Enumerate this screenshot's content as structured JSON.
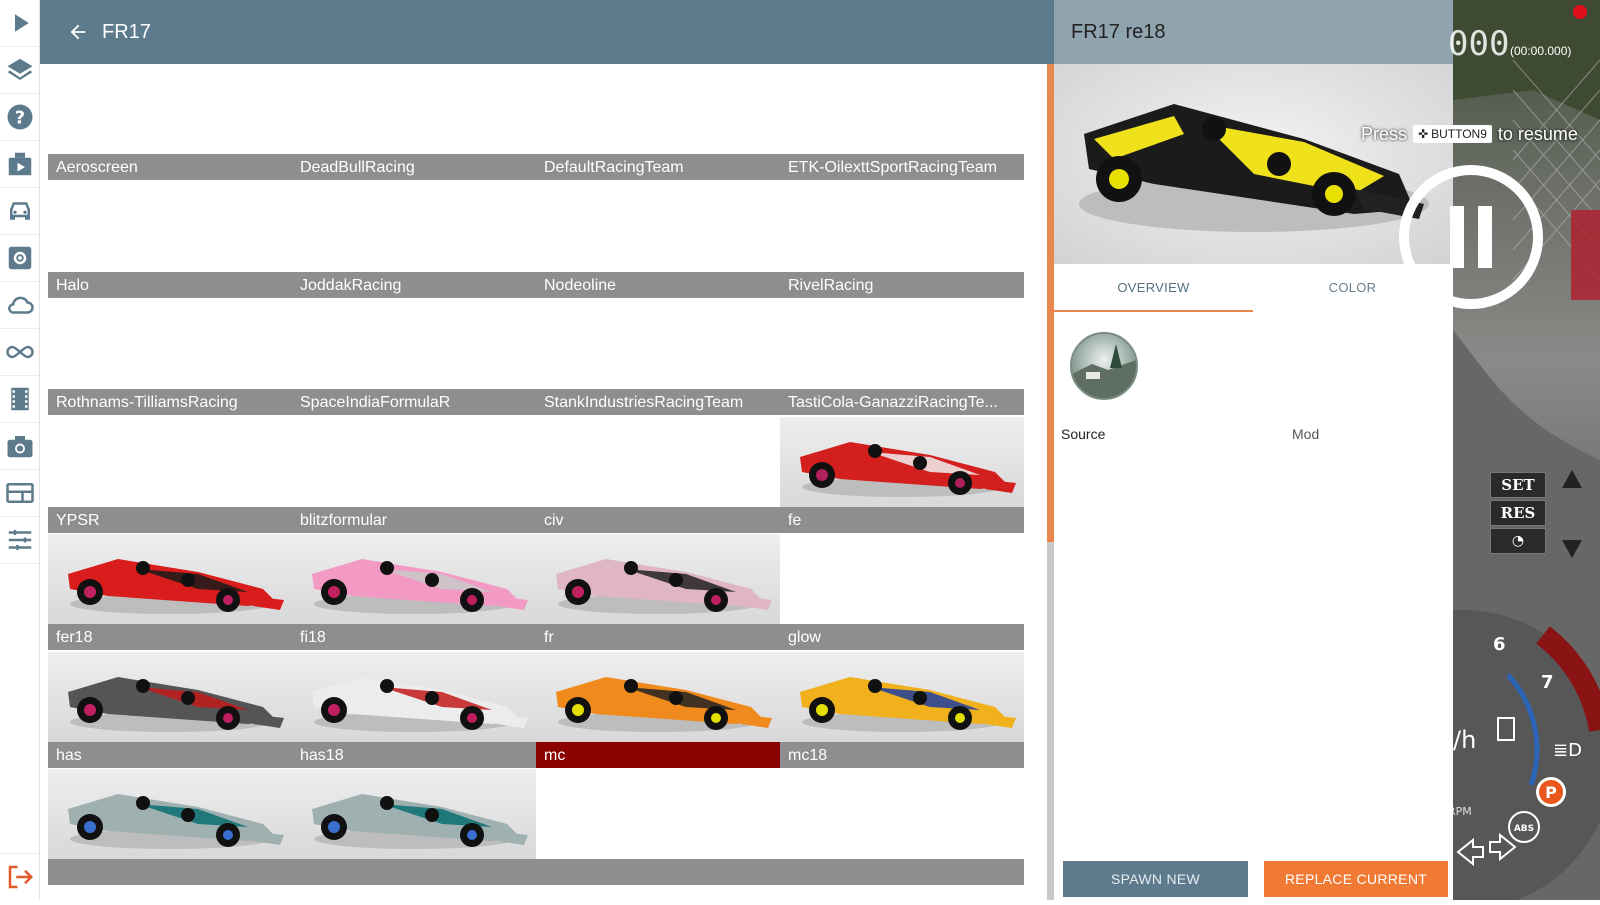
{
  "header": {
    "title": "FR17"
  },
  "sidebar": {
    "items": [
      {
        "name": "play-icon"
      },
      {
        "name": "layers-icon"
      },
      {
        "name": "help-icon"
      },
      {
        "name": "scenario-icon"
      },
      {
        "name": "car-icon"
      },
      {
        "name": "settings-icon"
      },
      {
        "name": "cloud-icon"
      },
      {
        "name": "infinity-icon"
      },
      {
        "name": "film-icon"
      },
      {
        "name": "camera-icon"
      },
      {
        "name": "display-icon"
      },
      {
        "name": "sliders-icon"
      },
      {
        "name": "exit-icon"
      }
    ]
  },
  "grid": {
    "tiles": [
      {
        "label": "Aeroscreen",
        "car": null
      },
      {
        "label": "DeadBullRacing",
        "car": null
      },
      {
        "label": "DefaultRacingTeam",
        "car": null
      },
      {
        "label": "ETK-OilexttSportRacingTeam",
        "car": null
      },
      {
        "label": "Halo",
        "car": null
      },
      {
        "label": "JoddakRacing",
        "car": null
      },
      {
        "label": "Nodeoline",
        "car": null
      },
      {
        "label": "RivelRacing",
        "car": null
      },
      {
        "label": "Rothnams-TilliamsRacing",
        "car": null
      },
      {
        "label": "SpaceIndiaFormulaR",
        "car": null
      },
      {
        "label": "StankIndustriesRacingTeam",
        "car": null
      },
      {
        "label": "TastiCola-GanazziRacingTe...",
        "car": null
      },
      {
        "label": "YPSR",
        "car": null
      },
      {
        "label": "blitzformular",
        "car": null
      },
      {
        "label": "civ",
        "car": null
      },
      {
        "label": "fe",
        "car": {
          "body": "#d41f1f",
          "accent": "#f0f0f0",
          "tire": "#b0205a"
        }
      },
      {
        "label": "fer18",
        "car": {
          "body": "#d91c1c",
          "accent": "#1a1a1a",
          "tire": "#c02060"
        }
      },
      {
        "label": "fi18",
        "car": {
          "body": "#f29ac4",
          "accent": "#c9c9c9",
          "tire": "#c02060"
        }
      },
      {
        "label": "fr",
        "car": {
          "body": "#e0b6c4",
          "accent": "#222222",
          "tire": "#c02060"
        }
      },
      {
        "label": "glow",
        "car": null
      },
      {
        "label": "has",
        "car": {
          "body": "#555555",
          "accent": "#c21b1b",
          "tire": "#c02060"
        }
      },
      {
        "label": "has18",
        "car": {
          "body": "#ececec",
          "accent": "#c21b1b",
          "tire": "#c02060"
        }
      },
      {
        "label": "mc",
        "car": {
          "body": "#f08a1c",
          "accent": "#222222",
          "tire": "#e3e000"
        },
        "selected": true
      },
      {
        "label": "mc18",
        "car": {
          "body": "#f0b11c",
          "accent": "#1f3fa0",
          "tire": "#e3e000"
        }
      },
      {
        "label": "",
        "car": {
          "body": "#9fb0b0",
          "accent": "#0a6e72",
          "tire": "#3a6ed0"
        }
      },
      {
        "label": "",
        "car": {
          "body": "#9fb0b0",
          "accent": "#0a6e72",
          "tire": "#3a6ed0"
        }
      },
      {
        "label": "",
        "car": null
      },
      {
        "label": "",
        "car": null
      }
    ]
  },
  "panel": {
    "title": "FR17 re18",
    "tabs": [
      "OVERVIEW",
      "COLOR"
    ],
    "active_tab": "OVERVIEW",
    "source_key": "Source",
    "source_value": "Mod",
    "spawn_label": "SPAWN NEW",
    "replace_label": "REPLACE CURRENT"
  },
  "overlay": {
    "time": "000",
    "time_sub": "(00:00.000)",
    "resume_prefix": "Press",
    "resume_key": "BUTTON9",
    "resume_suffix": "to resume",
    "cruise_set": "SET",
    "cruise_res": "RES",
    "gear_6": "6",
    "gear_7": "7",
    "rpm": "RPM",
    "abs": "ABS",
    "park": "P",
    "speed_unit": "/h"
  },
  "colors": {
    "header": "#5d7b8c",
    "panel_header": "#8fa4ae",
    "accent": "#f07a33",
    "selected": "#8b0000"
  }
}
